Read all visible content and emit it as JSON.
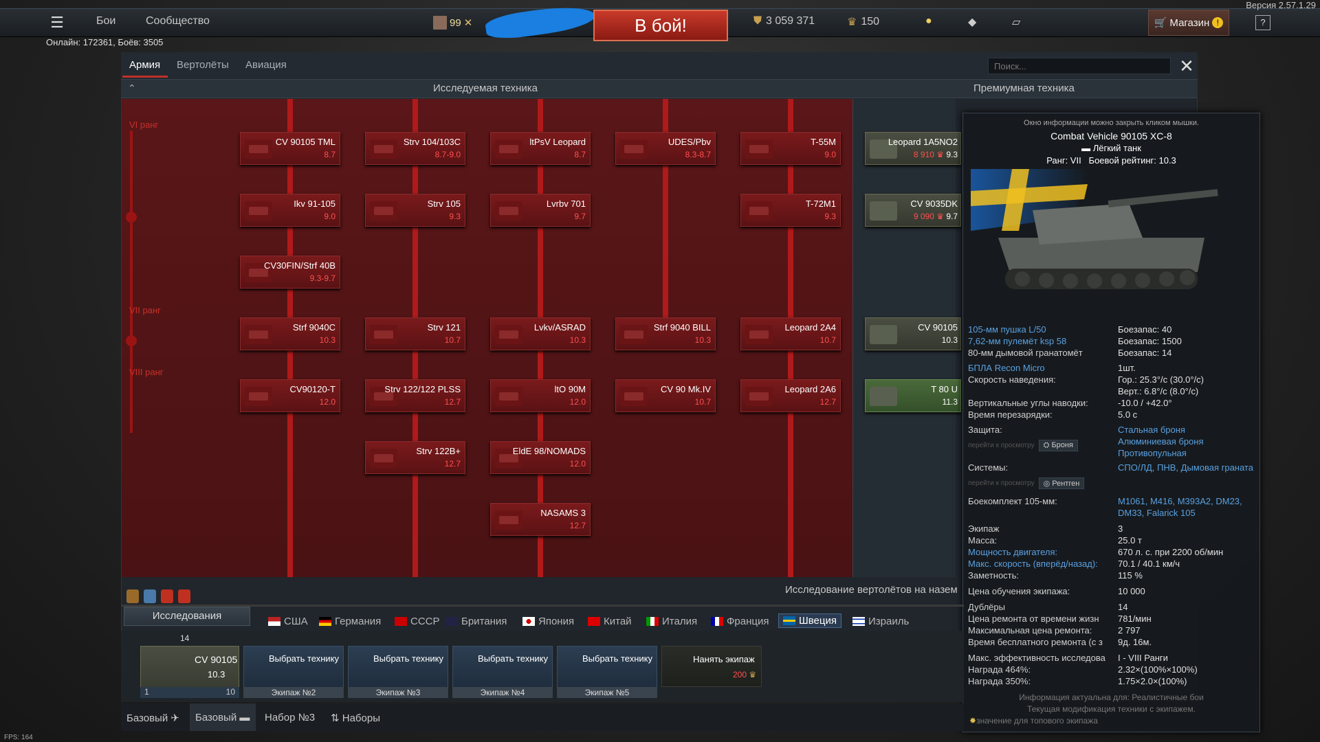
{
  "version": "Версия 2.57.1.29",
  "topbar": {
    "nav": [
      "Бои",
      "Сообщество"
    ],
    "player_level": "99",
    "battle_button": "В бой!",
    "silver_lions": "3 059 371",
    "golden_eagles": "150",
    "shop_label": "Магазин"
  },
  "online_status": "Онлайн: 172361, Боёв: 3505",
  "tabs": [
    "Армия",
    "Вертолёты",
    "Авиация"
  ],
  "search_placeholder": "Поиск...",
  "headers": {
    "research": "Исследуемая техника",
    "premium": "Премиумная техника"
  },
  "ranks": [
    "VI ранг",
    "VII ранг",
    "VIII ранг"
  ],
  "tree": [
    {
      "name": "CV 90105 TML",
      "br": "8.7"
    },
    {
      "name": "Strv 104/103C",
      "br": "8.7-9.0"
    },
    {
      "name": "ltPsV Leopard",
      "br": "8.7"
    },
    {
      "name": "UDES/Pbv",
      "br": "8.3-8.7"
    },
    {
      "name": "T-55M",
      "br": "9.0"
    },
    {
      "name": "Ikv 91-105",
      "br": "9.0"
    },
    {
      "name": "Strv 105",
      "br": "9.3"
    },
    {
      "name": "Lvrbv 701",
      "br": "9.7"
    },
    {
      "name": "T-72M1",
      "br": "9.3"
    },
    {
      "name": "CV30FIN/Strf 40B",
      "br": "9.3-9.7"
    },
    {
      "name": "Strf 9040C",
      "br": "10.3"
    },
    {
      "name": "Strv 121",
      "br": "10.7"
    },
    {
      "name": "Lvkv/ASRAD",
      "br": "10.3"
    },
    {
      "name": "Strf 9040 BILL",
      "br": "10.3"
    },
    {
      "name": "Leopard 2A4",
      "br": "10.7"
    },
    {
      "name": "CV90120-T",
      "br": "12.0"
    },
    {
      "name": "Strv 122/122 PLSS",
      "br": "12.7"
    },
    {
      "name": "ltO 90M",
      "br": "12.0"
    },
    {
      "name": "CV 90 Mk.IV",
      "br": "10.7"
    },
    {
      "name": "Leopard 2A6",
      "br": "12.7"
    },
    {
      "name": "Strv 122B+",
      "br": "12.7"
    },
    {
      "name": "EldE 98/NOMADS",
      "br": "12.0"
    },
    {
      "name": "NASAMS 3",
      "br": "12.7"
    }
  ],
  "premium": [
    {
      "name": "Leopard 1A5NO2",
      "price": "8 910",
      "br": "9.3"
    },
    {
      "name": "CV 9035DK",
      "price": "9 090",
      "br": "9.7"
    },
    {
      "name": "CV 90105",
      "br": "10.3"
    },
    {
      "name": "T 80 U",
      "br": "11.3"
    }
  ],
  "info": {
    "hint": "Окно информации можно закрыть кликом мышки.",
    "title": "Combat Vehicle 90105 XC-8",
    "class": "Лёгкий танк",
    "rank": "Ранг: VII",
    "rating": "Боевой рейтинг: 10.3",
    "specs": [
      {
        "k": "105-мм пушка L/50",
        "v": "Боезапас: 40",
        "link": true
      },
      {
        "k": "7,62-мм пулемёт ksp 58",
        "v": "Боезапас: 1500",
        "link": true
      },
      {
        "k": "80-мм дымовой гранатомёт",
        "v": "Боезапас: 14",
        "link": false
      },
      {
        "k": "БПЛА Recon Micro",
        "v": "1шт.",
        "link": true
      },
      {
        "k": "Скорость наведения:",
        "v": "Гор.: 25.3°/с (30.0°/с)",
        "link": false
      },
      {
        "k": "",
        "v": "Верт.: 6.8°/с (8.0°/с)",
        "link": false
      },
      {
        "k": "Вертикальные углы наводки:",
        "v": "-10.0 / +42.0°",
        "link": false
      },
      {
        "k": "Время перезарядки:",
        "v": "5.0 с",
        "link": false
      }
    ],
    "protection_label": "Защита:",
    "protection": [
      "Стальная броня",
      "Алюминиевая броня",
      "Противопульная"
    ],
    "goto_view": "перейти к просмотру",
    "armor_btn": "Броня",
    "systems_label": "Системы:",
    "systems": "СПО/ЛД, ПНВ, Дымовая граната",
    "xray_btn": "Рентген",
    "ammo_label": "Боекомплект 105-мм:",
    "ammo": "M1061, M416, M393A2, DM23,",
    "ammo2": "DM33, Falarick 105",
    "specs2": [
      {
        "k": "Экипаж",
        "v": "3",
        "link": false
      },
      {
        "k": "Масса:",
        "v": "25.0 т",
        "link": false
      },
      {
        "k": "Мощность двигателя:",
        "v": "670 л. с. при 2200 об/мин",
        "link": true
      },
      {
        "k": "Макс. скорость (вперёд/назад):",
        "v": "70.1 / 40.1 км/ч",
        "link": true
      },
      {
        "k": "Заметность:",
        "v": "115 %",
        "link": false
      },
      {
        "k": "Цена обучения экипажа:",
        "v": "10 000",
        "link": false
      },
      {
        "k": "Дублёры",
        "v": "14",
        "link": false
      },
      {
        "k": "Цена ремонта от времени жизн",
        "v": "781/мин",
        "link": false
      },
      {
        "k": "Максимальная цена ремонта:",
        "v": "2 797",
        "link": false
      },
      {
        "k": "Время бесплатного ремонта (с з",
        "v": "9д. 16м.",
        "link": false
      },
      {
        "k": "Макс. эффективность исследова",
        "v": "I - VIII Ранги",
        "link": false
      },
      {
        "k": "Награда 464%:",
        "v": "2.32×(100%×100%)",
        "link": false
      },
      {
        "k": "Награда 350%:",
        "v": "1.75×2.0×(100%)",
        "link": false
      }
    ],
    "footer1": "Информация актуальна для: Реалистичные бои",
    "footer2": "Текущая модификация техники с экипажем.",
    "footer3": "значение для топового экипажа"
  },
  "bottom": {
    "hint": "Исследование вертолётов на назем",
    "research_btn": "Исследования",
    "nations": [
      "США",
      "Германия",
      "СССР",
      "Британия",
      "Япония",
      "Китай",
      "Италия",
      "Франция",
      "Швеция",
      "Израиль"
    ],
    "active_nation": "Швеция",
    "main_slot": {
      "name": "CV 90105",
      "br": "10.3",
      "spares": "14",
      "crew": "1",
      "level": "10"
    },
    "slots": [
      {
        "label": "Выбрать технику",
        "crew": "Экипаж №2"
      },
      {
        "label": "Выбрать технику",
        "crew": "Экипаж №3"
      },
      {
        "label": "Выбрать технику",
        "crew": "Экипаж №4"
      },
      {
        "label": "Выбрать технику",
        "crew": "Экипаж №5"
      }
    ],
    "hire": {
      "label": "Нанять экипаж",
      "price": "200"
    },
    "tabs": [
      "Базовый",
      "Базовый",
      "Набор №3",
      "Наборы"
    ]
  },
  "fps": "FPS: 164",
  "colors": {
    "accent": "#c0302a",
    "tree_bg": "#5a1618",
    "link": "#5aa0e0"
  }
}
